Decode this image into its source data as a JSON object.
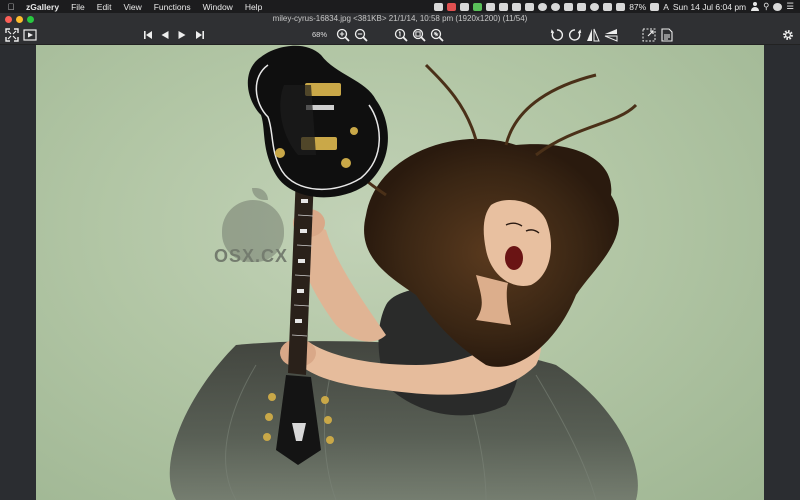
{
  "menubar": {
    "app_name": "zGallery",
    "menus": [
      "File",
      "Edit",
      "View",
      "Functions",
      "Window",
      "Help"
    ],
    "battery": "87%",
    "datetime": "Sun 14 Jul  6:04 pm"
  },
  "window": {
    "title": "miley-cyrus-16834.jpg <381KB> 21/1/14, 10:58 pm (1920x1200) (11/54)"
  },
  "toolbar": {
    "zoom_level": "68%"
  },
  "watermark": {
    "text": "OSX.CX"
  },
  "colors": {
    "close": "#fc5f57",
    "minimize": "#fdbc2e",
    "maximize": "#28c840",
    "photo_background": "#b2c6a5",
    "chrome": "#2f3033"
  }
}
